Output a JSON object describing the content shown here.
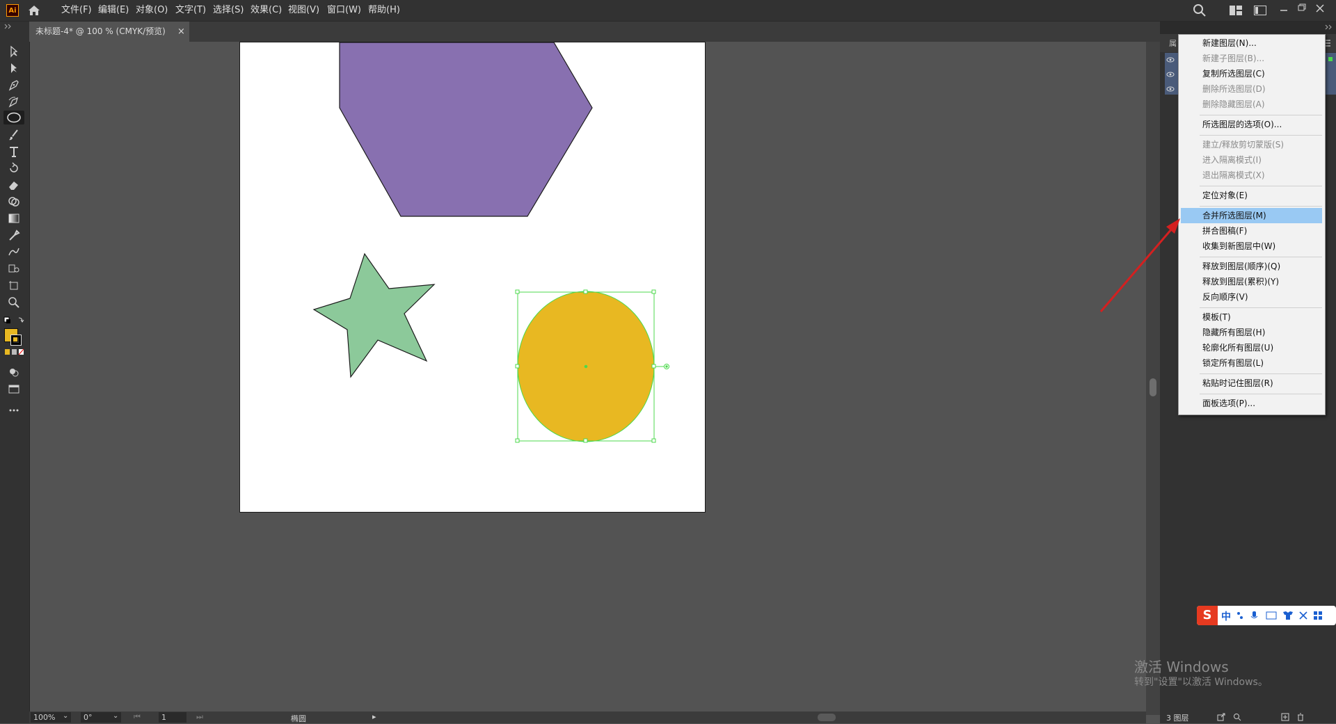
{
  "app": {
    "logo": "Ai"
  },
  "menu": [
    {
      "label": "文件(F)"
    },
    {
      "label": "编辑(E)"
    },
    {
      "label": "对象(O)"
    },
    {
      "label": "文字(T)"
    },
    {
      "label": "选择(S)"
    },
    {
      "label": "效果(C)"
    },
    {
      "label": "视图(V)"
    },
    {
      "label": "窗口(W)"
    },
    {
      "label": "帮助(H)"
    }
  ],
  "tab": {
    "title": "未标题-4* @ 100 % (CMYK/预览)",
    "close": "×"
  },
  "panel": {
    "tab_label": "属",
    "layers_count_label": "3 图层"
  },
  "context_menu": {
    "items": [
      {
        "label": "新建图层(N)...",
        "state": "enabled"
      },
      {
        "label": "新建子图层(B)...",
        "state": "disabled"
      },
      {
        "label": "复制所选图层(C)",
        "state": "enabled"
      },
      {
        "label": "删除所选图层(D)",
        "state": "disabled"
      },
      {
        "label": "删除隐藏图层(A)",
        "state": "disabled"
      },
      {
        "label": "所选图层的选项(O)...",
        "state": "enabled"
      },
      {
        "label": "建立/释放剪切蒙版(S)",
        "state": "disabled"
      },
      {
        "label": "进入隔离模式(I)",
        "state": "disabled"
      },
      {
        "label": "退出隔离模式(X)",
        "state": "disabled"
      },
      {
        "label": "定位对象(E)",
        "state": "enabled"
      },
      {
        "label": "合并所选图层(M)",
        "state": "highlighted"
      },
      {
        "label": "拼合图稿(F)",
        "state": "enabled"
      },
      {
        "label": "收集到新图层中(W)",
        "state": "enabled"
      },
      {
        "label": "释放到图层(顺序)(Q)",
        "state": "enabled"
      },
      {
        "label": "释放到图层(累积)(Y)",
        "state": "enabled"
      },
      {
        "label": "反向顺序(V)",
        "state": "enabled"
      },
      {
        "label": "模板(T)",
        "state": "enabled"
      },
      {
        "label": "隐藏所有图层(H)",
        "state": "enabled"
      },
      {
        "label": "轮廓化所有图层(U)",
        "state": "enabled"
      },
      {
        "label": "锁定所有图层(L)",
        "state": "enabled"
      },
      {
        "label": "粘贴时记住图层(R)",
        "state": "enabled"
      },
      {
        "label": "面板选项(P)...",
        "state": "enabled"
      }
    ]
  },
  "status": {
    "zoom": "100%",
    "rotation": "0°",
    "artboard": "1",
    "selection": "椭圆"
  },
  "ime": {
    "mode": "中"
  },
  "watermark": {
    "line1": "激活 Windows",
    "line2": "转到\"设置\"以激活 Windows。"
  },
  "colors": {
    "hexagon": "#8870b0",
    "star": "#8cc99a",
    "circle": "#e8b822",
    "selection": "#4cd94c",
    "fill_swatch": "#e8b822",
    "arrow": "#d42020"
  }
}
